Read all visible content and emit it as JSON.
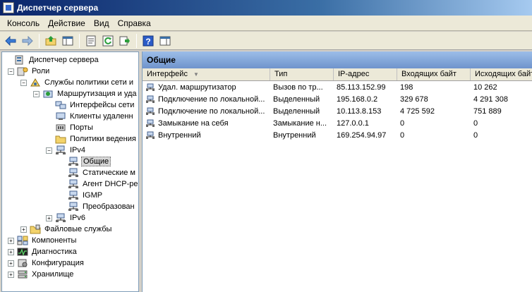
{
  "window": {
    "title": "Диспетчер сервера"
  },
  "menu": [
    "Консоль",
    "Действие",
    "Вид",
    "Справка"
  ],
  "toolbar": {
    "buttons": [
      "back-icon",
      "forward-icon",
      "up-folder-icon",
      "show-hide-tree-icon",
      "properties-icon",
      "refresh-icon",
      "export-list-icon",
      "help-icon",
      "show-action-pane-icon"
    ]
  },
  "tree": {
    "items": [
      {
        "label": "Диспетчер сервера",
        "level": 0,
        "expander": "",
        "icon": "server-manager-icon"
      },
      {
        "label": "Роли",
        "level": 1,
        "expander": "−",
        "icon": "roles-icon"
      },
      {
        "label": "Службы политики сети и",
        "level": 2,
        "expander": "−",
        "icon": "network-policy-icon"
      },
      {
        "label": "Маршрутизация и уда",
        "level": 3,
        "expander": "−",
        "icon": "routing-icon"
      },
      {
        "label": "Интерфейсы сети",
        "level": 4,
        "expander": "",
        "icon": "network-interface-icon"
      },
      {
        "label": "Клиенты удаленн",
        "level": 4,
        "expander": "",
        "icon": "remote-clients-icon"
      },
      {
        "label": "Порты",
        "level": 4,
        "expander": "",
        "icon": "ports-icon"
      },
      {
        "label": "Политики ведения",
        "level": 4,
        "expander": "",
        "icon": "folder-icon"
      },
      {
        "label": "IPv4",
        "level": 4,
        "expander": "−",
        "icon": "network-icon"
      },
      {
        "label": "Общие",
        "level": 5,
        "expander": "",
        "icon": "network-icon",
        "selected": true
      },
      {
        "label": "Статические м",
        "level": 5,
        "expander": "",
        "icon": "network-icon"
      },
      {
        "label": "Агент DHCP-ре",
        "level": 5,
        "expander": "",
        "icon": "network-icon"
      },
      {
        "label": "IGMP",
        "level": 5,
        "expander": "",
        "icon": "network-icon"
      },
      {
        "label": "Преобразован",
        "level": 5,
        "expander": "",
        "icon": "network-icon"
      },
      {
        "label": "IPv6",
        "level": 4,
        "expander": "+",
        "icon": "network-icon"
      },
      {
        "label": "Файловые службы",
        "level": 2,
        "expander": "+",
        "icon": "file-services-icon"
      },
      {
        "label": "Компоненты",
        "level": 1,
        "expander": "+",
        "icon": "components-icon"
      },
      {
        "label": "Диагностика",
        "level": 1,
        "expander": "+",
        "icon": "diagnostics-icon"
      },
      {
        "label": "Конфигурация",
        "level": 1,
        "expander": "+",
        "icon": "configuration-icon"
      },
      {
        "label": "Хранилище",
        "level": 1,
        "expander": "+",
        "icon": "storage-icon"
      }
    ]
  },
  "main": {
    "header": "Общие",
    "columns": [
      "Интерфейс",
      "Тип",
      "IP-адрес",
      "Входящих байт",
      "Исходящих байт"
    ],
    "rows": [
      [
        "Удал. маршрутизатор",
        "Вызов по тр...",
        "85.113.152.99",
        "198",
        "10 262"
      ],
      [
        "Подключение по локальной...",
        "Выделенный",
        "195.168.0.2",
        "329 678",
        "4 291 308"
      ],
      [
        "Подключение по локальной...",
        "Выделенный",
        "10.113.8.153",
        "4 725 592",
        "751 889"
      ],
      [
        "Замыкание на себя",
        "Замыкание н...",
        "127.0.0.1",
        "0",
        "0"
      ],
      [
        "Внутренний",
        "Внутренний",
        "169.254.94.97",
        "0",
        "0"
      ]
    ]
  }
}
